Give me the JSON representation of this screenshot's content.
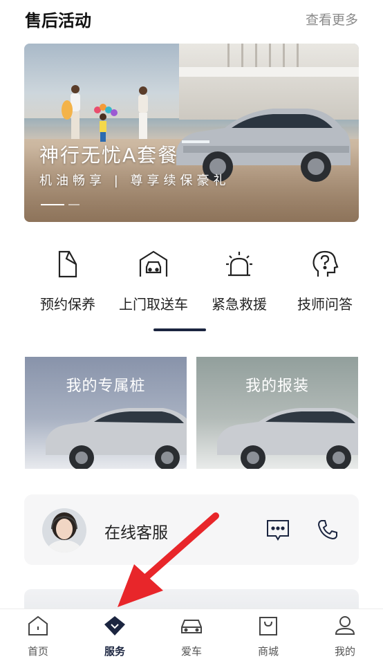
{
  "header": {
    "title": "售后活动",
    "more_label": "查看更多"
  },
  "banner": {
    "headline": "神行无忧A套餐",
    "subline": "机油畅享 | 尊享续保豪礼"
  },
  "services": [
    {
      "label": "预约保养",
      "icon": "maintenance-doc-icon"
    },
    {
      "label": "上门取送车",
      "icon": "garage-car-icon"
    },
    {
      "label": "紧急救援",
      "icon": "siren-icon"
    },
    {
      "label": "技师问答",
      "icon": "question-head-icon"
    }
  ],
  "cards": [
    {
      "label": "我的专属桩"
    },
    {
      "label": "我的报装"
    }
  ],
  "customer_service": {
    "label": "在线客服"
  },
  "nav": [
    {
      "label": "首页",
      "icon": "home-icon"
    },
    {
      "label": "服务",
      "icon": "service-diamond-icon"
    },
    {
      "label": "爱车",
      "icon": "car-icon"
    },
    {
      "label": "商城",
      "icon": "shopping-bag-icon"
    },
    {
      "label": "我的",
      "icon": "profile-icon"
    }
  ],
  "colors": {
    "accent": "#1b2540",
    "card_left": "#8b95ab",
    "card_right": "#97a39f"
  }
}
